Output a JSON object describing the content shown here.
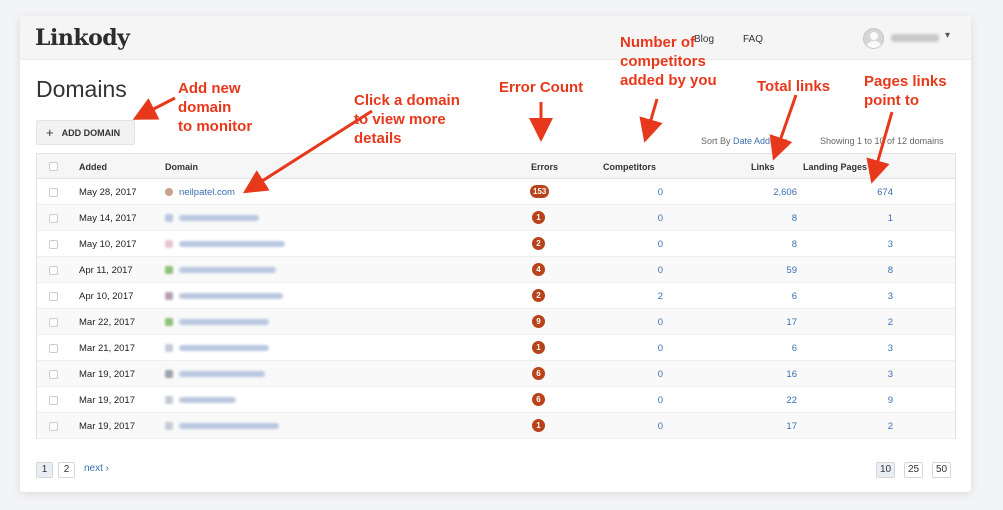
{
  "app": {
    "logo": "Linkody"
  },
  "nav": {
    "blog": "Blog",
    "faq": "FAQ",
    "user_chevron": "▾"
  },
  "page": {
    "title": "Domains",
    "add_button": "ADD DOMAIN",
    "add_icon": "+"
  },
  "toolbar": {
    "sort_prefix": "Sort By",
    "sort_value": "Date Added",
    "sort_chevron": "▾",
    "showing": "Showing 1 to 10 of 12 domains"
  },
  "table": {
    "columns": {
      "added": "Added",
      "domain": "Domain",
      "errors": "Errors",
      "competitors": "Competitors",
      "links": "Links",
      "landing_pages": "Landing Pages"
    },
    "rows": [
      {
        "added": "May 28, 2017",
        "domain": "neilpatel.com",
        "errors": "153",
        "competitors": "0",
        "links": "2,606",
        "landing_pages": "674"
      },
      {
        "added": "May 14, 2017",
        "domain": "",
        "errors": "1",
        "competitors": "0",
        "links": "8",
        "landing_pages": "1"
      },
      {
        "added": "May 10, 2017",
        "domain": "",
        "errors": "2",
        "competitors": "0",
        "links": "8",
        "landing_pages": "3"
      },
      {
        "added": "Apr 11, 2017",
        "domain": "",
        "errors": "4",
        "competitors": "0",
        "links": "59",
        "landing_pages": "8"
      },
      {
        "added": "Apr 10, 2017",
        "domain": "",
        "errors": "2",
        "competitors": "2",
        "links": "6",
        "landing_pages": "3"
      },
      {
        "added": "Mar 22, 2017",
        "domain": "",
        "errors": "9",
        "competitors": "0",
        "links": "17",
        "landing_pages": "2"
      },
      {
        "added": "Mar 21, 2017",
        "domain": "",
        "errors": "1",
        "competitors": "0",
        "links": "6",
        "landing_pages": "3"
      },
      {
        "added": "Mar 19, 2017",
        "domain": "",
        "errors": "6",
        "competitors": "0",
        "links": "16",
        "landing_pages": "3"
      },
      {
        "added": "Mar 19, 2017",
        "domain": "",
        "errors": "6",
        "competitors": "0",
        "links": "22",
        "landing_pages": "9"
      },
      {
        "added": "Mar 19, 2017",
        "domain": "",
        "errors": "1",
        "competitors": "0",
        "links": "17",
        "landing_pages": "2"
      }
    ]
  },
  "pagination": {
    "pages": [
      "1",
      "2"
    ],
    "next": "next ›",
    "page_sizes": [
      "10",
      "25",
      "50"
    ]
  },
  "annotations": {
    "add_domain": [
      "Add new",
      "domain",
      "to monitor"
    ],
    "click_domain": [
      "Click a domain",
      "to view more",
      "details"
    ],
    "error_count": [
      "Error Count"
    ],
    "competitors": [
      "Number of",
      "competitors",
      "added by you"
    ],
    "total_links": [
      "Total links"
    ],
    "pages_links": [
      "Pages links",
      "point to"
    ]
  },
  "colors": {
    "accent": "#e8381c",
    "badge": "#b8431b",
    "link": "#3a6fb0"
  }
}
